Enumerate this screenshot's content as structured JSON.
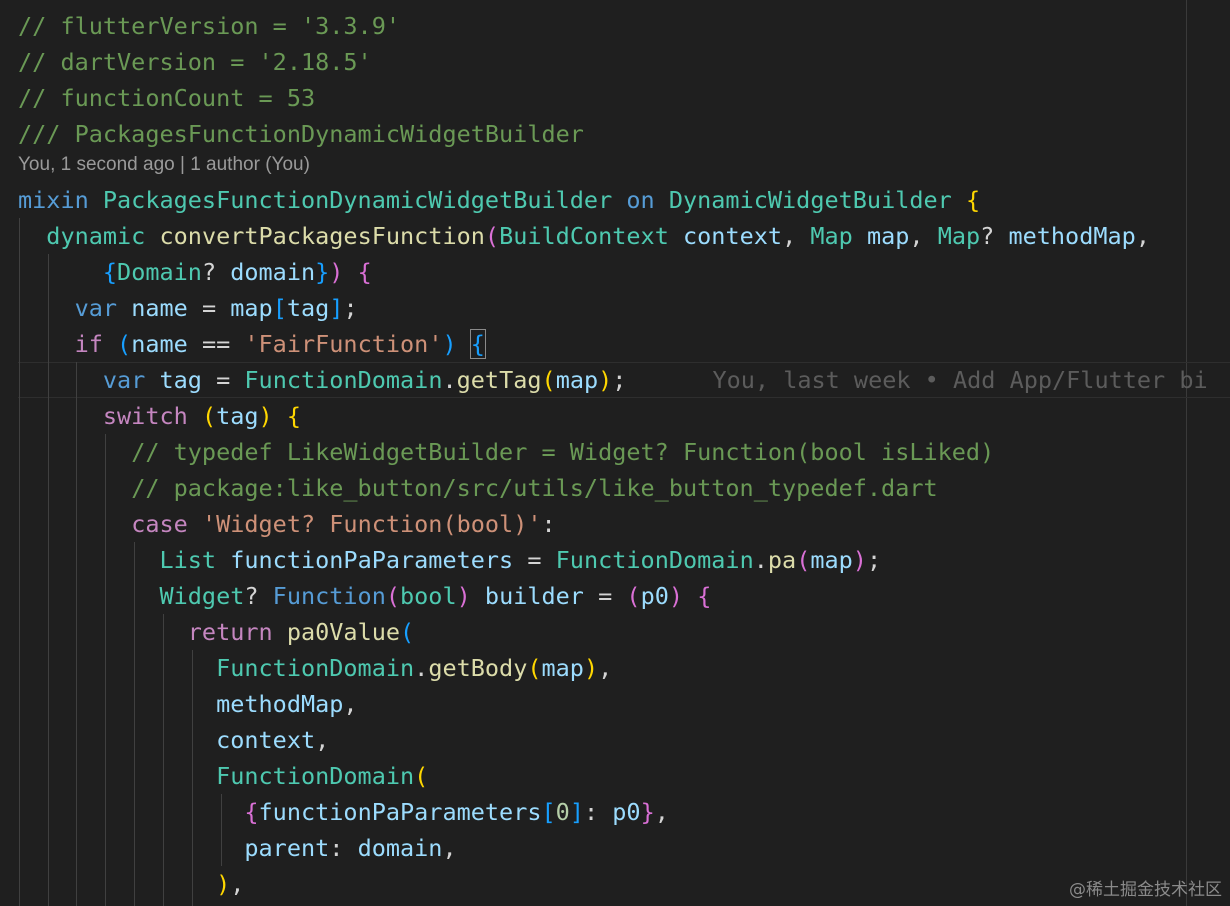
{
  "editor": {
    "code_lens": "You, 1 second ago | 1 author (You)",
    "inline_blame": "You, last week • Add App/Flutter bi",
    "watermark": "@稀土掘金技术社区"
  },
  "lines": [
    [
      [
        "c",
        "// flutterVersion = '3.3.9'"
      ]
    ],
    [
      [
        "c",
        "// dartVersion = '2.18.5'"
      ]
    ],
    [
      [
        "c",
        "// functionCount = 53"
      ]
    ],
    [
      [
        "c",
        "/// PackagesFunctionDynamicWidgetBuilder"
      ]
    ],
    [
      [
        "kw",
        "mixin "
      ],
      [
        "ty",
        "PackagesFunctionDynamicWidgetBuilder"
      ],
      [
        "p",
        " "
      ],
      [
        "kw",
        "on"
      ],
      [
        "p",
        " "
      ],
      [
        "ty",
        "DynamicWidgetBuilder"
      ],
      [
        "p",
        " "
      ],
      [
        "b1",
        "{"
      ]
    ],
    [
      [
        "p",
        "  "
      ],
      [
        "ty",
        "dynamic"
      ],
      [
        "p",
        " "
      ],
      [
        "fn",
        "convertPackagesFunction"
      ],
      [
        "b2",
        "("
      ],
      [
        "ty",
        "BuildContext"
      ],
      [
        "p",
        " "
      ],
      [
        "v",
        "context"
      ],
      [
        "p",
        ", "
      ],
      [
        "ty",
        "Map"
      ],
      [
        "p",
        " "
      ],
      [
        "v",
        "map"
      ],
      [
        "p",
        ", "
      ],
      [
        "ty",
        "Map"
      ],
      [
        "p",
        "? "
      ],
      [
        "v",
        "methodMap"
      ],
      [
        "p",
        ","
      ]
    ],
    [
      [
        "p",
        "      "
      ],
      [
        "b3",
        "{"
      ],
      [
        "ty",
        "Domain"
      ],
      [
        "p",
        "? "
      ],
      [
        "v",
        "domain"
      ],
      [
        "b3",
        "}"
      ],
      [
        "b2",
        ")"
      ],
      [
        "p",
        " "
      ],
      [
        "b2",
        "{"
      ]
    ],
    [
      [
        "p",
        "    "
      ],
      [
        "kw",
        "var"
      ],
      [
        "p",
        " "
      ],
      [
        "v",
        "name"
      ],
      [
        "p",
        " = "
      ],
      [
        "v",
        "map"
      ],
      [
        "b3",
        "["
      ],
      [
        "v",
        "tag"
      ],
      [
        "b3",
        "]"
      ],
      [
        "p",
        ";"
      ]
    ],
    [
      [
        "p",
        "    "
      ],
      [
        "kc",
        "if"
      ],
      [
        "p",
        " "
      ],
      [
        "b3",
        "("
      ],
      [
        "v",
        "name"
      ],
      [
        "p",
        " == "
      ],
      [
        "s",
        "'FairFunction'"
      ],
      [
        "b3",
        ")"
      ],
      [
        "p",
        " "
      ],
      [
        "b3",
        "{",
        "box"
      ]
    ],
    [
      [
        "p",
        "      "
      ],
      [
        "kw",
        "var"
      ],
      [
        "p",
        " "
      ],
      [
        "v",
        "tag"
      ],
      [
        "p",
        " = "
      ],
      [
        "ty",
        "FunctionDomain"
      ],
      [
        "p",
        "."
      ],
      [
        "fn",
        "getTag"
      ],
      [
        "b1",
        "("
      ],
      [
        "v",
        "map"
      ],
      [
        "b1",
        ")"
      ],
      [
        "p",
        ";"
      ],
      [
        "blame",
        "editor.inline_blame"
      ]
    ],
    [
      [
        "p",
        "      "
      ],
      [
        "kc",
        "switch"
      ],
      [
        "p",
        " "
      ],
      [
        "b1",
        "("
      ],
      [
        "v",
        "tag"
      ],
      [
        "b1",
        ")"
      ],
      [
        "p",
        " "
      ],
      [
        "b1",
        "{"
      ]
    ],
    [
      [
        "p",
        "        "
      ],
      [
        "c",
        "// typedef LikeWidgetBuilder = Widget? Function(bool isLiked)"
      ]
    ],
    [
      [
        "p",
        "        "
      ],
      [
        "c",
        "// package:like_button/src/utils/like_button_typedef.dart"
      ]
    ],
    [
      [
        "p",
        "        "
      ],
      [
        "kc",
        "case"
      ],
      [
        "p",
        " "
      ],
      [
        "s",
        "'Widget? Function(bool)'"
      ],
      [
        "p",
        ":"
      ]
    ],
    [
      [
        "p",
        "          "
      ],
      [
        "ty",
        "List"
      ],
      [
        "p",
        " "
      ],
      [
        "v",
        "functionPaParameters"
      ],
      [
        "p",
        " = "
      ],
      [
        "ty",
        "FunctionDomain"
      ],
      [
        "p",
        "."
      ],
      [
        "fn",
        "pa"
      ],
      [
        "b2",
        "("
      ],
      [
        "v",
        "map"
      ],
      [
        "b2",
        ")"
      ],
      [
        "p",
        ";"
      ]
    ],
    [
      [
        "p",
        "          "
      ],
      [
        "ty",
        "Widget"
      ],
      [
        "p",
        "? "
      ],
      [
        "kw",
        "Function"
      ],
      [
        "b2",
        "("
      ],
      [
        "ty",
        "bool"
      ],
      [
        "b2",
        ")"
      ],
      [
        "p",
        " "
      ],
      [
        "v",
        "builder"
      ],
      [
        "p",
        " = "
      ],
      [
        "b2",
        "("
      ],
      [
        "v",
        "p0"
      ],
      [
        "b2",
        ")"
      ],
      [
        "p",
        " "
      ],
      [
        "b2",
        "{"
      ]
    ],
    [
      [
        "p",
        "            "
      ],
      [
        "kc",
        "return"
      ],
      [
        "p",
        " "
      ],
      [
        "fn",
        "pa0Value"
      ],
      [
        "b3",
        "("
      ]
    ],
    [
      [
        "p",
        "              "
      ],
      [
        "ty",
        "FunctionDomain"
      ],
      [
        "p",
        "."
      ],
      [
        "fn",
        "getBody"
      ],
      [
        "b1",
        "("
      ],
      [
        "v",
        "map"
      ],
      [
        "b1",
        ")"
      ],
      [
        "p",
        ","
      ]
    ],
    [
      [
        "p",
        "              "
      ],
      [
        "v",
        "methodMap"
      ],
      [
        "p",
        ","
      ]
    ],
    [
      [
        "p",
        "              "
      ],
      [
        "v",
        "context"
      ],
      [
        "p",
        ","
      ]
    ],
    [
      [
        "p",
        "              "
      ],
      [
        "ty",
        "FunctionDomain"
      ],
      [
        "b1",
        "("
      ]
    ],
    [
      [
        "p",
        "                "
      ],
      [
        "b2",
        "{"
      ],
      [
        "v",
        "functionPaParameters"
      ],
      [
        "b3",
        "["
      ],
      [
        "n",
        "0"
      ],
      [
        "b3",
        "]"
      ],
      [
        "p",
        ": "
      ],
      [
        "v",
        "p0"
      ],
      [
        "b2",
        "}"
      ],
      [
        "p",
        ","
      ]
    ],
    [
      [
        "p",
        "                "
      ],
      [
        "v",
        "parent"
      ],
      [
        "p",
        ": "
      ],
      [
        "v",
        "domain"
      ],
      [
        "p",
        ","
      ]
    ],
    [
      [
        "p",
        "              "
      ],
      [
        "b1",
        ")"
      ],
      [
        "p",
        ","
      ]
    ]
  ]
}
